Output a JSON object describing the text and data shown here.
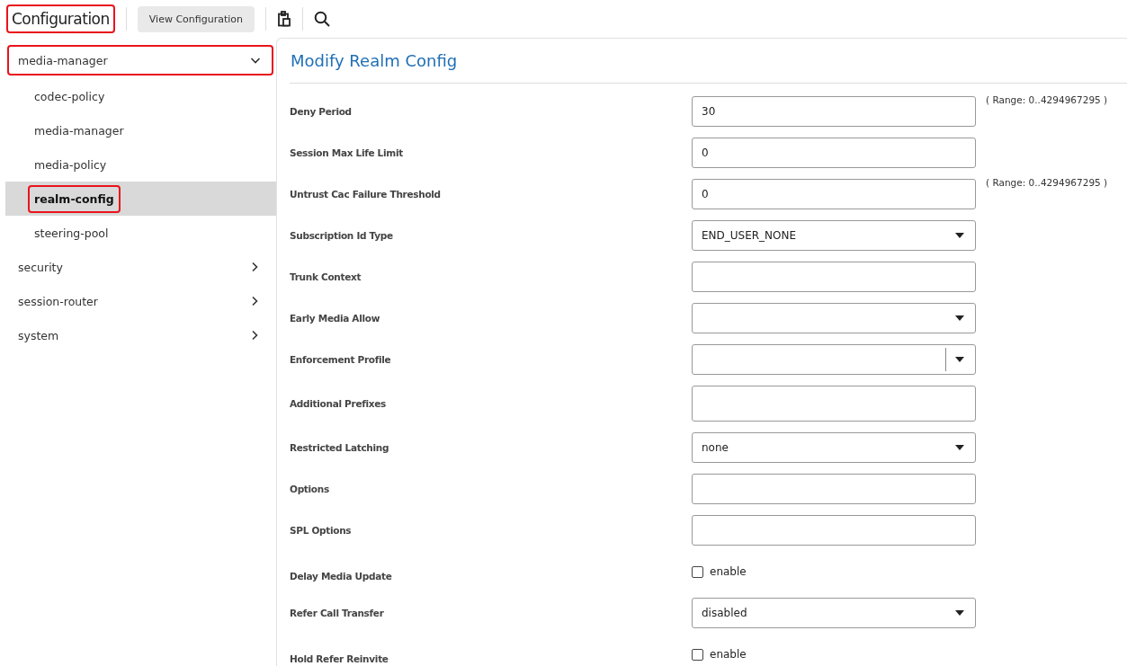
{
  "toolbar": {
    "title": "Configuration",
    "title_highlighted": true,
    "view_button": "View Configuration"
  },
  "sidebar": {
    "items": [
      {
        "label": "media-manager",
        "expanded": true,
        "highlighted": true,
        "children": [
          {
            "label": "codec-policy",
            "selected": false,
            "highlighted": false
          },
          {
            "label": "media-manager",
            "selected": false,
            "highlighted": false
          },
          {
            "label": "media-policy",
            "selected": false,
            "highlighted": false
          },
          {
            "label": "realm-config",
            "selected": true,
            "highlighted": true
          },
          {
            "label": "steering-pool",
            "selected": false,
            "highlighted": false
          }
        ]
      },
      {
        "label": "security",
        "expanded": false,
        "highlighted": false
      },
      {
        "label": "session-router",
        "expanded": false,
        "highlighted": false
      },
      {
        "label": "system",
        "expanded": false,
        "highlighted": false
      }
    ]
  },
  "form": {
    "title": "Modify Realm Config",
    "fields": [
      {
        "label": "Deny Period",
        "kind": "text",
        "value": "30",
        "note": "( Range: 0..4294967295 )"
      },
      {
        "label": "Session Max Life Limit",
        "kind": "text",
        "value": "0"
      },
      {
        "label": "Untrust Cac Failure Threshold",
        "kind": "text",
        "value": "0",
        "note": "( Range: 0..4294967295 )"
      },
      {
        "label": "Subscription Id Type",
        "kind": "select",
        "value": "END_USER_NONE"
      },
      {
        "label": "Trunk Context",
        "kind": "text"
      },
      {
        "label": "Early Media Allow",
        "kind": "select"
      },
      {
        "label": "Enforcement Profile",
        "kind": "combo"
      },
      {
        "label": "Additional Prefixes",
        "kind": "text",
        "tall": true
      },
      {
        "label": "Restricted Latching",
        "kind": "select",
        "value": "none"
      },
      {
        "label": "Options",
        "kind": "text"
      },
      {
        "label": "SPL Options",
        "kind": "text"
      },
      {
        "label": "Delay Media Update",
        "kind": "checkbox",
        "checked": false,
        "option": "enable"
      },
      {
        "label": "Refer Call Transfer",
        "kind": "select",
        "value": "disabled"
      },
      {
        "label": "Hold Refer Reinvite",
        "kind": "checkbox",
        "checked": false,
        "option": "enable"
      }
    ]
  }
}
